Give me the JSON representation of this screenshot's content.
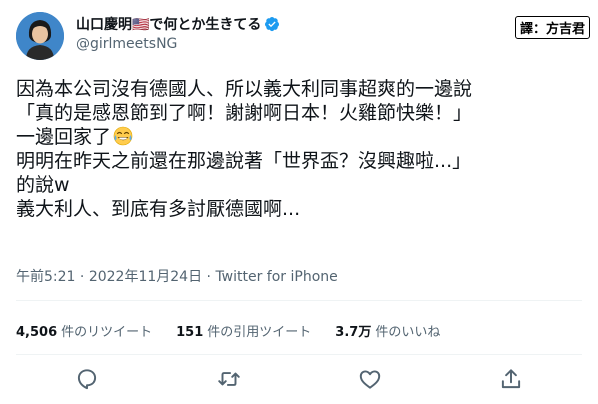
{
  "user": {
    "display_name": "山口慶明🇺🇸で何とか生きてる",
    "handle": "@girlmeetsNG"
  },
  "watermark": "譯：方吉君",
  "tweet": {
    "lines": [
      "因為本公司沒有德國人、所以義大利同事超爽的一邊說",
      "「真的是感恩節到了啊！謝謝啊日本！火雞節快樂！」",
      "一邊回家了",
      "明明在昨天之前還在那邊說著「世界盃？沒興趣啦...」",
      "的說w",
      "義大利人、到底有多討厭德國啊..."
    ],
    "emoji": "laughing-tears-emoji"
  },
  "meta": {
    "time": "午前5:21",
    "separator1": " · ",
    "date": "2022年11月24日",
    "separator2": " · ",
    "source": "Twitter for iPhone"
  },
  "stats": [
    {
      "count": "4,506",
      "label": "件のリツイート"
    },
    {
      "count": "151",
      "label": "件の引用ツイート"
    },
    {
      "count": "3.7万",
      "label": "件のいいね"
    }
  ],
  "colors": {
    "text": "#0f1419",
    "secondary": "#536471",
    "verified": "#1d9bf0",
    "divider": "#eff3f4"
  },
  "icons": [
    "reply-icon",
    "retweet-icon",
    "like-icon",
    "share-icon"
  ]
}
